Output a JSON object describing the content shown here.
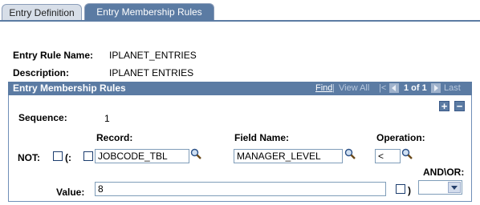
{
  "tabs": [
    {
      "label": "Entry Definition"
    },
    {
      "label": "Entry Membership Rules"
    }
  ],
  "header": {
    "rule_name_label": "Entry Rule Name:",
    "rule_name_value": "IPLANET_ENTRIES",
    "description_label": "Description:",
    "description_value": "IPLANET ENTRIES"
  },
  "grid": {
    "title": "Entry Membership Rules",
    "nav_find": "Find",
    "nav_view_all": "View All",
    "nav_first": "|<",
    "nav_count": "1 of 1",
    "nav_last": "Last",
    "add_symbol": "+",
    "remove_symbol": "−"
  },
  "row": {
    "sequence_label": "Sequence:",
    "sequence_value": "1",
    "record_label": "Record:",
    "field_name_label": "Field Name:",
    "operation_label": "Operation:",
    "not_label": "NOT:",
    "open_paren": "(:",
    "record_value": "JOBCODE_TBL",
    "field_name_value": "MANAGER_LEVEL",
    "operation_value": "<",
    "and_or_label": "AND\\OR:",
    "value_label": "Value:",
    "value_value": "8",
    "close_paren": ")",
    "and_or_selected": ""
  },
  "colors": {
    "accent": "#5b7ba3",
    "tab_inactive": "#d7dee8"
  }
}
